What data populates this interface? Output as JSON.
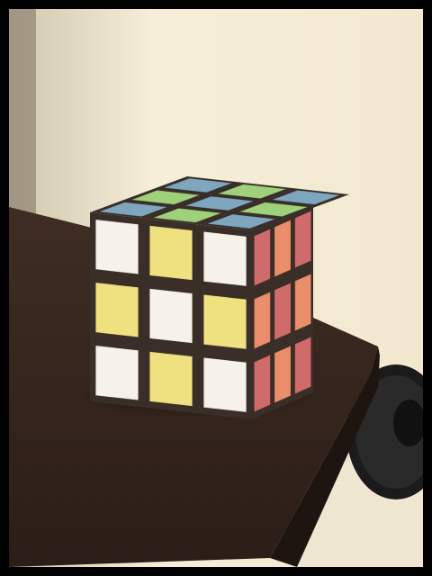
{
  "scene": {
    "subject": "rubiks-cube",
    "surface": "dark-wood-table",
    "background": "cream-wall",
    "extra": "desk-fan"
  },
  "palette": {
    "wall_light": "#f6eed8",
    "wall_shadow": "#c8bfa6",
    "table_top": "#3b2a22",
    "table_edge": "#251913",
    "floor": "#efe6d2",
    "white": "#f6f2ea",
    "yellow": "#efe080",
    "green": "#9fd07a",
    "blue": "#7ea6be",
    "orange": "#e98d6a",
    "red": "#d06b6b",
    "border": "#000000"
  },
  "cube": {
    "top": [
      [
        "blue",
        "green",
        "blue"
      ],
      [
        "green",
        "blue",
        "green"
      ],
      [
        "blue",
        "green",
        "blue"
      ]
    ],
    "front": [
      [
        "white",
        "yellow",
        "white"
      ],
      [
        "yellow",
        "white",
        "yellow"
      ],
      [
        "white",
        "yellow",
        "white"
      ]
    ],
    "right": [
      [
        "red",
        "orange",
        "red"
      ],
      [
        "orange",
        "red",
        "orange"
      ],
      [
        "red",
        "orange",
        "red"
      ]
    ]
  }
}
